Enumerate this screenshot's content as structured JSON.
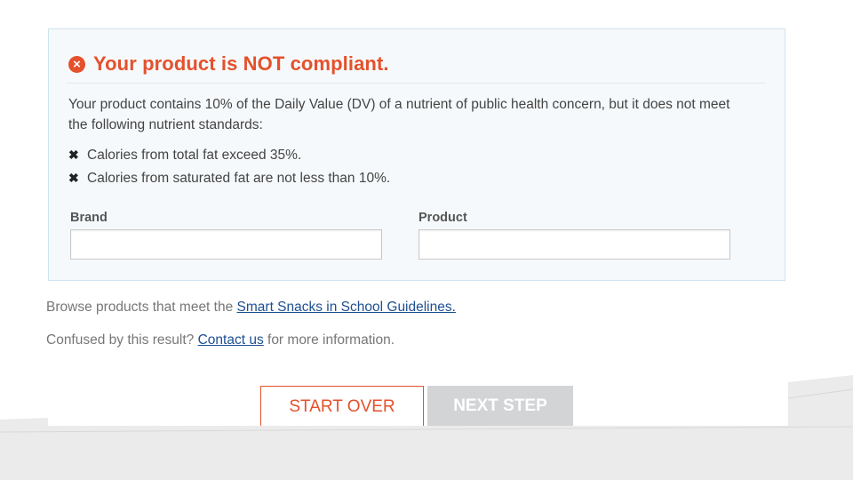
{
  "result": {
    "title": "Your product is NOT compliant.",
    "status_icon": "error-circle-icon",
    "description": "Your product contains 10% of the Daily Value (DV) of a nutrient of public health concern, but it does not meet the following nutrient standards:",
    "issues": [
      {
        "icon": "x-mark-icon",
        "text": "Calories from total fat exceed 35%."
      },
      {
        "icon": "x-mark-icon",
        "text": "Calories from saturated fat are not less than 10%."
      }
    ],
    "fields": {
      "brand_label": "Brand",
      "brand_value": "",
      "product_label": "Product",
      "product_value": ""
    }
  },
  "browse": {
    "prefix": "Browse products that meet the ",
    "link": "Smart Snacks in School Guidelines."
  },
  "confused": {
    "prefix": "Confused by this result? ",
    "link": "Contact us",
    "suffix": " for more information."
  },
  "buttons": {
    "start_over": "START OVER",
    "next_step": "NEXT STEP"
  },
  "colors": {
    "error": "#e4512c",
    "link": "#1d4f91",
    "disabled_button": "#d3d4d6",
    "panel_background": "#f6f9fb"
  }
}
